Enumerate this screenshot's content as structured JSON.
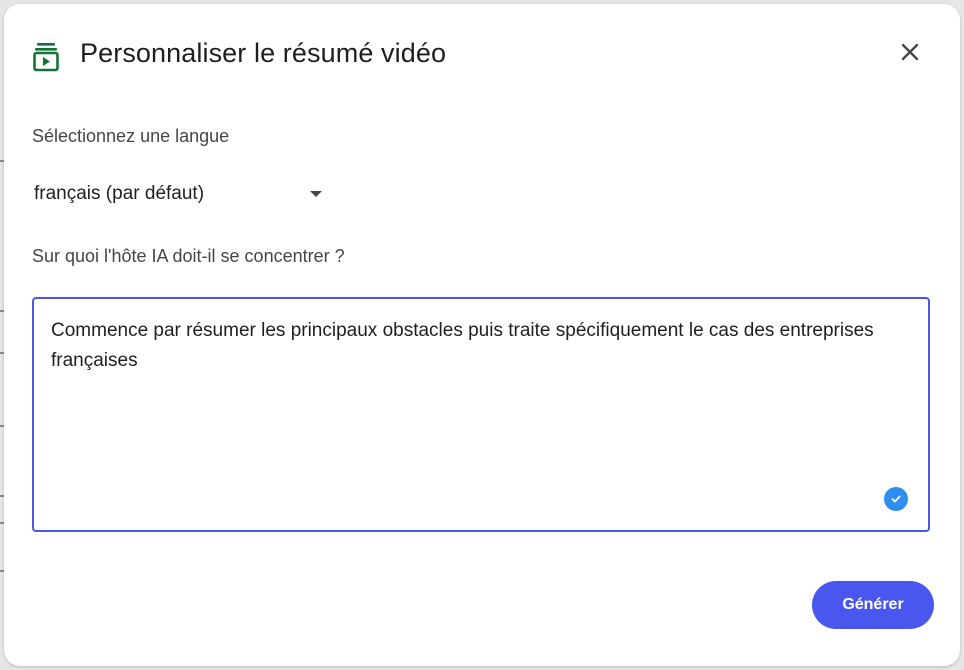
{
  "dialog": {
    "title": "Personnaliser le résumé vidéo",
    "icon": "video-summary-icon",
    "close_icon": "close-icon"
  },
  "language": {
    "label": "Sélectionnez une langue",
    "selected": "français (par défaut)"
  },
  "focus": {
    "label": "Sur quoi l'hôte IA doit-il se concentrer ?",
    "value": "Commence par résumer les principaux obstacles puis traite spécifiquement le cas des entreprises françaises"
  },
  "actions": {
    "generate_label": "Générer"
  },
  "colors": {
    "accent": "#4a57ef",
    "icon_green": "#137333",
    "check_blue": "#2e8ff0"
  }
}
